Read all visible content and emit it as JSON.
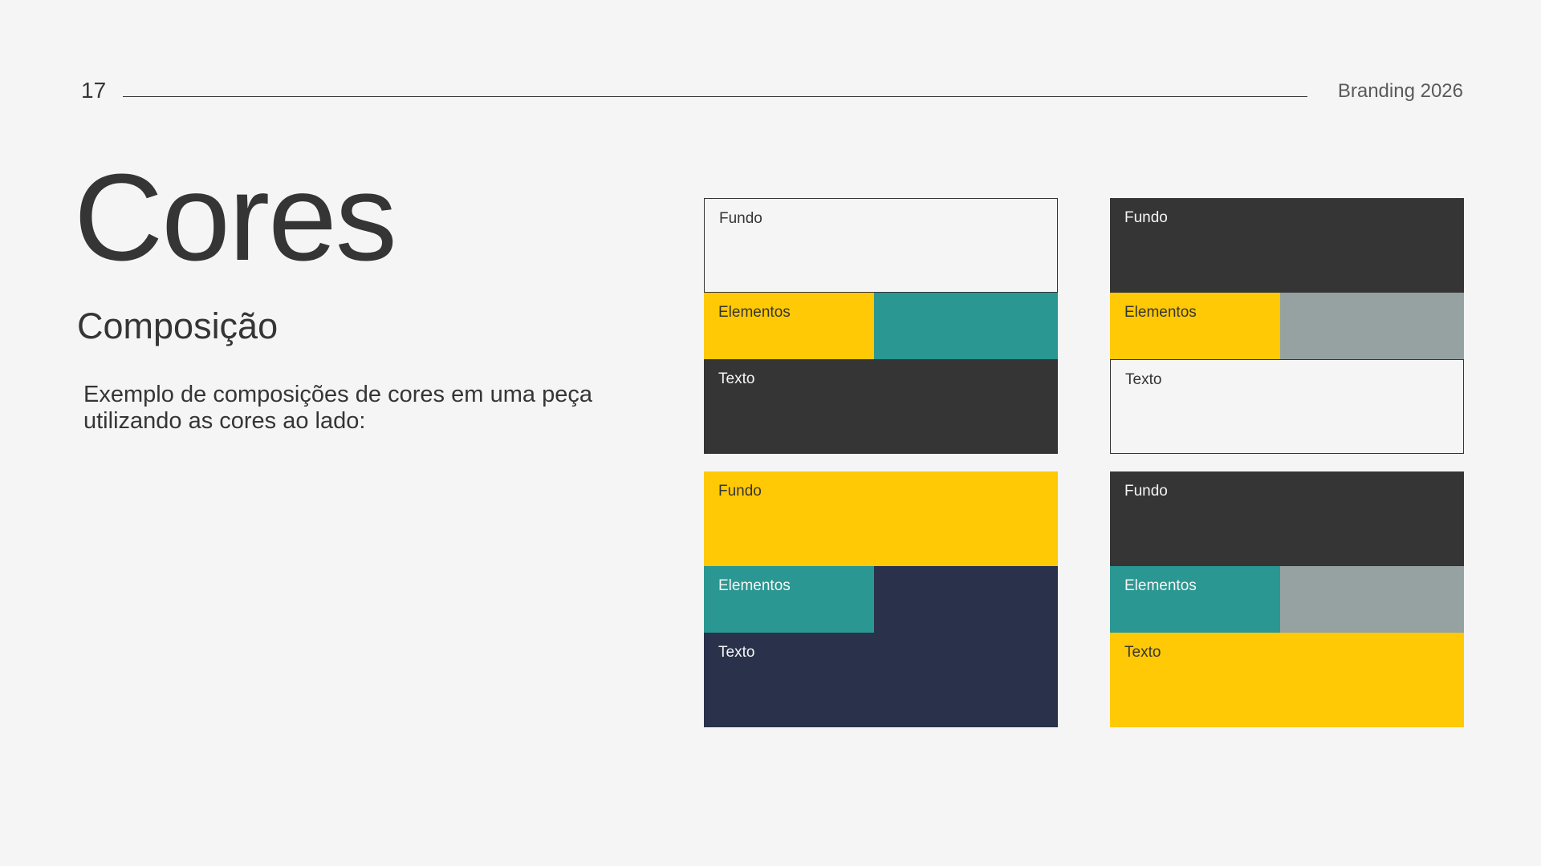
{
  "header": {
    "page_number": "17",
    "label": "Branding 2026"
  },
  "main": {
    "title": "Cores",
    "subtitle": "Composição",
    "description": "Exemplo de composições de cores em uma peça utilizando as cores ao lado:"
  },
  "colors": {
    "white": "#f5f5f5",
    "dark": "#353535",
    "yellow": "#ffc905",
    "teal": "#2a9792",
    "gray": "#95a2a1",
    "navy": "#29314b"
  },
  "compositions": [
    {
      "fundo": {
        "label": "Fundo",
        "color": "#f5f5f5",
        "text_color": "#353535",
        "outlined": true
      },
      "elementos": {
        "label": "Elementos",
        "color_a": "#ffc905",
        "color_b": "#2a9792",
        "text_color": "#353535"
      },
      "texto": {
        "label": "Texto",
        "color": "#353535",
        "text_color": "#f5f5f5",
        "outlined": false
      }
    },
    {
      "fundo": {
        "label": "Fundo",
        "color": "#353535",
        "text_color": "#f5f5f5",
        "outlined": false
      },
      "elementos": {
        "label": "Elementos",
        "color_a": "#ffc905",
        "color_b": "#95a2a1",
        "text_color": "#353535"
      },
      "texto": {
        "label": "Texto",
        "color": "#f5f5f5",
        "text_color": "#353535",
        "outlined": true
      }
    },
    {
      "fundo": {
        "label": "Fundo",
        "color": "#ffc905",
        "text_color": "#353535",
        "outlined": false
      },
      "elementos": {
        "label": "Elementos",
        "color_a": "#2a9792",
        "color_b": "#29314b",
        "text_color": "#f5f5f5"
      },
      "texto": {
        "label": "Texto",
        "color": "#29314b",
        "text_color": "#f5f5f5",
        "outlined": false
      }
    },
    {
      "fundo": {
        "label": "Fundo",
        "color": "#353535",
        "text_color": "#f5f5f5",
        "outlined": false
      },
      "elementos": {
        "label": "Elementos",
        "color_a": "#2a9792",
        "color_b": "#95a2a1",
        "text_color": "#f5f5f5"
      },
      "texto": {
        "label": "Texto",
        "color": "#ffc905",
        "text_color": "#353535",
        "outlined": false
      }
    }
  ]
}
